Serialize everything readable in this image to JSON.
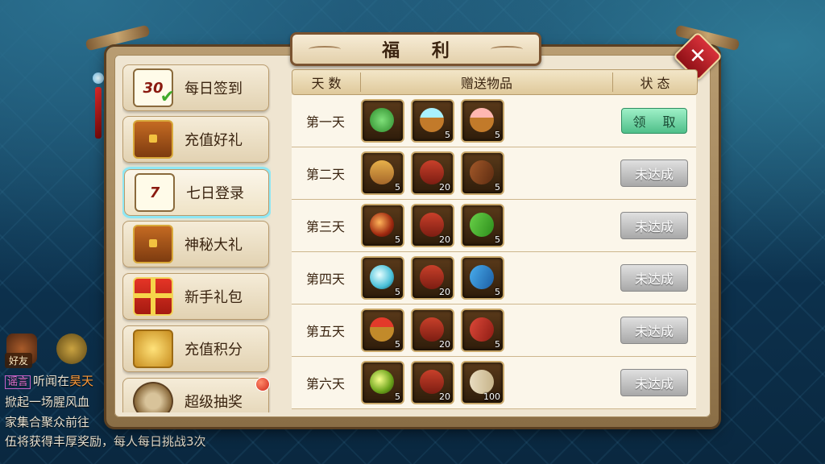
{
  "window": {
    "title": "福 利",
    "close_label": "✕"
  },
  "hud": {
    "friend_label": "好友",
    "chat_lines": [
      {
        "tag": "谣言",
        "text": "听闻在",
        "name": "昊天"
      },
      {
        "text": "掀起一场腥风血"
      },
      {
        "text": "家集合聚众前往"
      },
      {
        "text": "伍将获得丰厚奖励，每人每日挑战3次"
      }
    ]
  },
  "sidebar": {
    "items": [
      {
        "label": "每日签到",
        "icon": "calendar-30-icon",
        "icon_text": "30"
      },
      {
        "label": "充值好礼",
        "icon": "treasure-chest-icon"
      },
      {
        "label": "七日登录",
        "icon": "calendar-7-icon",
        "icon_text": "7",
        "active": true
      },
      {
        "label": "神秘大礼",
        "icon": "mystery-chest-icon"
      },
      {
        "label": "新手礼包",
        "icon": "gift-box-icon"
      },
      {
        "label": "充值积分",
        "icon": "gold-pile-icon"
      },
      {
        "label": "超级抽奖",
        "icon": "lottery-wheel-icon",
        "badge": true
      }
    ]
  },
  "table": {
    "headers": {
      "day": "天 数",
      "items": "赠送物品",
      "status": "状 态"
    },
    "rows": [
      {
        "day": "第一天",
        "items": [
          {
            "icon": "leaf-icon",
            "count": ""
          },
          {
            "icon": "blue-bowl-icon",
            "count": "5"
          },
          {
            "icon": "pink-bowl-icon",
            "count": "5"
          }
        ],
        "status": "领 取",
        "claimable": true
      },
      {
        "day": "第二天",
        "items": [
          {
            "icon": "hat-icon",
            "count": "5"
          },
          {
            "icon": "banner-icon",
            "count": "20"
          },
          {
            "icon": "brown-book-icon",
            "count": "5"
          }
        ],
        "status": "未达成",
        "claimable": false
      },
      {
        "day": "第三天",
        "items": [
          {
            "icon": "red-orb-icon",
            "count": "5"
          },
          {
            "icon": "banner-icon",
            "count": "20"
          },
          {
            "icon": "green-book-icon",
            "count": "5"
          }
        ],
        "status": "未达成",
        "claimable": false
      },
      {
        "day": "第四天",
        "items": [
          {
            "icon": "cyan-orb-icon",
            "count": "5"
          },
          {
            "icon": "banner-icon",
            "count": "20"
          },
          {
            "icon": "blue-book-icon",
            "count": "5"
          }
        ],
        "status": "未达成",
        "claimable": false
      },
      {
        "day": "第五天",
        "items": [
          {
            "icon": "boat-icon",
            "count": "5"
          },
          {
            "icon": "banner-icon",
            "count": "20"
          },
          {
            "icon": "red-book-icon",
            "count": "5"
          }
        ],
        "status": "未达成",
        "claimable": false
      },
      {
        "day": "第六天",
        "items": [
          {
            "icon": "pearl-icon",
            "count": "5"
          },
          {
            "icon": "banner-icon",
            "count": "20"
          },
          {
            "icon": "scroll-icon",
            "count": "100"
          }
        ],
        "status": "未达成",
        "claimable": false
      }
    ]
  }
}
